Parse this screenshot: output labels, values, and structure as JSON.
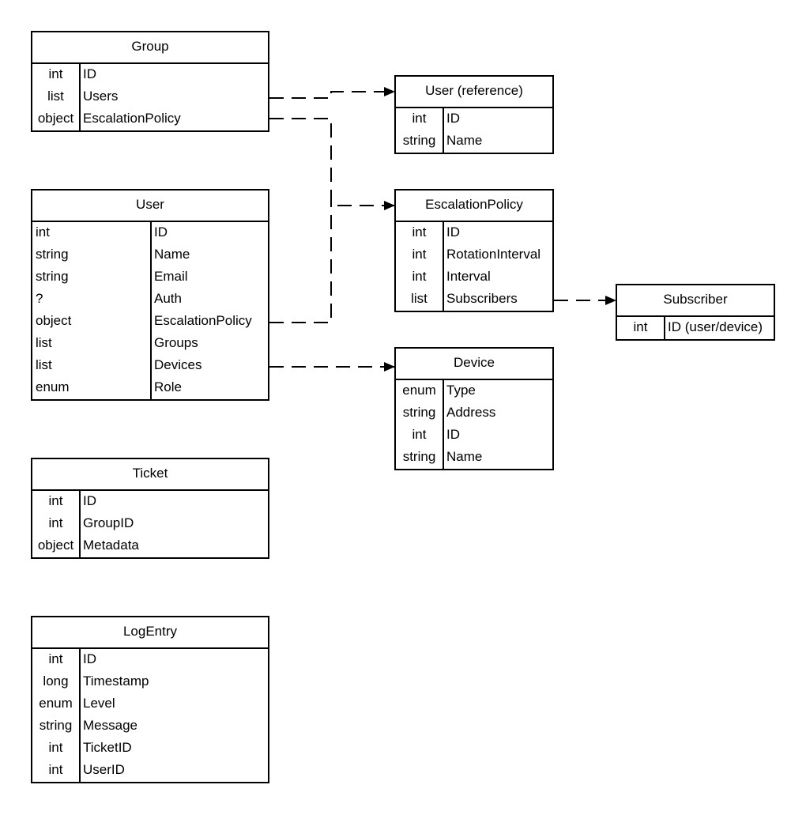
{
  "diagram": {
    "type": "entity-relationship",
    "entities": {
      "group": {
        "title": "Group",
        "fields": [
          {
            "type": "int",
            "name": "ID"
          },
          {
            "type": "list",
            "name": "Users"
          },
          {
            "type": "object",
            "name": "EscalationPolicy"
          }
        ]
      },
      "user": {
        "title": "User",
        "fields": [
          {
            "type": "int",
            "name": "ID"
          },
          {
            "type": "string",
            "name": "Name"
          },
          {
            "type": "string",
            "name": "Email"
          },
          {
            "type": "?",
            "name": "Auth"
          },
          {
            "type": "object",
            "name": "EscalationPolicy"
          },
          {
            "type": "list",
            "name": "Groups"
          },
          {
            "type": "list",
            "name": "Devices"
          },
          {
            "type": "enum",
            "name": "Role"
          }
        ]
      },
      "ticket": {
        "title": "Ticket",
        "fields": [
          {
            "type": "int",
            "name": "ID"
          },
          {
            "type": "int",
            "name": "GroupID"
          },
          {
            "type": "object",
            "name": "Metadata"
          }
        ]
      },
      "logentry": {
        "title": "LogEntry",
        "fields": [
          {
            "type": "int",
            "name": "ID"
          },
          {
            "type": "long",
            "name": "Timestamp"
          },
          {
            "type": "enum",
            "name": "Level"
          },
          {
            "type": "string",
            "name": "Message"
          },
          {
            "type": "int",
            "name": "TicketID"
          },
          {
            "type": "int",
            "name": "UserID"
          }
        ]
      },
      "user_reference": {
        "title": "User (reference)",
        "fields": [
          {
            "type": "int",
            "name": "ID"
          },
          {
            "type": "string",
            "name": "Name"
          }
        ]
      },
      "escalation_policy": {
        "title": "EscalationPolicy",
        "fields": [
          {
            "type": "int",
            "name": "ID"
          },
          {
            "type": "int",
            "name": "RotationInterval"
          },
          {
            "type": "int",
            "name": "Interval"
          },
          {
            "type": "list",
            "name": "Subscribers"
          }
        ]
      },
      "device": {
        "title": "Device",
        "fields": [
          {
            "type": "enum",
            "name": "Type"
          },
          {
            "type": "string",
            "name": "Address"
          },
          {
            "type": "int",
            "name": "ID"
          },
          {
            "type": "string",
            "name": "Name"
          }
        ]
      },
      "subscriber": {
        "title": "Subscriber",
        "fields": [
          {
            "type": "int",
            "name": "ID (user/device)"
          }
        ]
      }
    },
    "relationships": [
      {
        "from": "Group.Users",
        "to": "User (reference)",
        "style": "dashed",
        "arrow": "filled-triangle"
      },
      {
        "from": "Group.EscalationPolicy",
        "to": "EscalationPolicy",
        "style": "dashed",
        "arrow": "filled-triangle"
      },
      {
        "from": "User.EscalationPolicy",
        "to": "EscalationPolicy",
        "style": "dashed",
        "arrow": "filled-triangle"
      },
      {
        "from": "User.Devices",
        "to": "Device",
        "style": "dashed",
        "arrow": "filled-triangle"
      },
      {
        "from": "EscalationPolicy.Subscribers",
        "to": "Subscriber",
        "style": "dashed",
        "arrow": "filled-triangle"
      }
    ]
  }
}
